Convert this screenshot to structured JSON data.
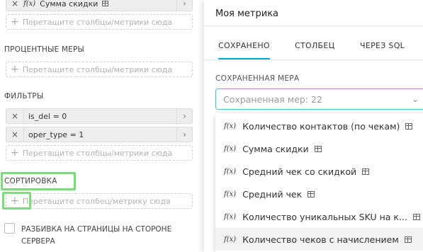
{
  "left": {
    "metrics_chip": {
      "label": "Сумма скидки"
    },
    "drop_placeholder": "Перетащите столбцы/метрики сюда",
    "percent_section": "ПРОЦЕНТНЫЕ МЕРЫ",
    "filters_section": "ФИЛЬТРЫ",
    "filters": [
      {
        "label": "is_del = 0"
      },
      {
        "label": "oper_type = 1"
      }
    ],
    "sort_section": "СОРТИРОВКА",
    "sort_placeholder": "Перетащите столбец/метрику сюда",
    "pagination_label": "РАЗБИВКА НА СТРАНИЦЫ НА СТОРОНЕ СЕРВЕРА"
  },
  "popup": {
    "title": "Моя метрика",
    "tabs": [
      {
        "label": "СОХРАНЕНО"
      },
      {
        "label": "СТОЛБЕЦ"
      },
      {
        "label": "ЧЕРЕЗ SQL"
      }
    ],
    "saved_label": "СОХРАНЕННАЯ МЕРА",
    "select_placeholder": "Сохраненная мер: 22",
    "options": [
      {
        "label": "Количество контактов (по чекам)"
      },
      {
        "label": "Сумма скидки"
      },
      {
        "label": "Средний чек со скидкой"
      },
      {
        "label": "Средний чек"
      },
      {
        "label": "Количество уникальных SKU на к..."
      },
      {
        "label": "Количество чеков с начислением"
      }
    ]
  },
  "icons": {
    "function": "f(x)",
    "close": "×",
    "chevron_right": "›",
    "chevron_down": "⌄",
    "plus": "+"
  },
  "colors": {
    "accent": "#00aac8",
    "highlight": "#7ddb7d",
    "select_border": "#52b8d0"
  }
}
